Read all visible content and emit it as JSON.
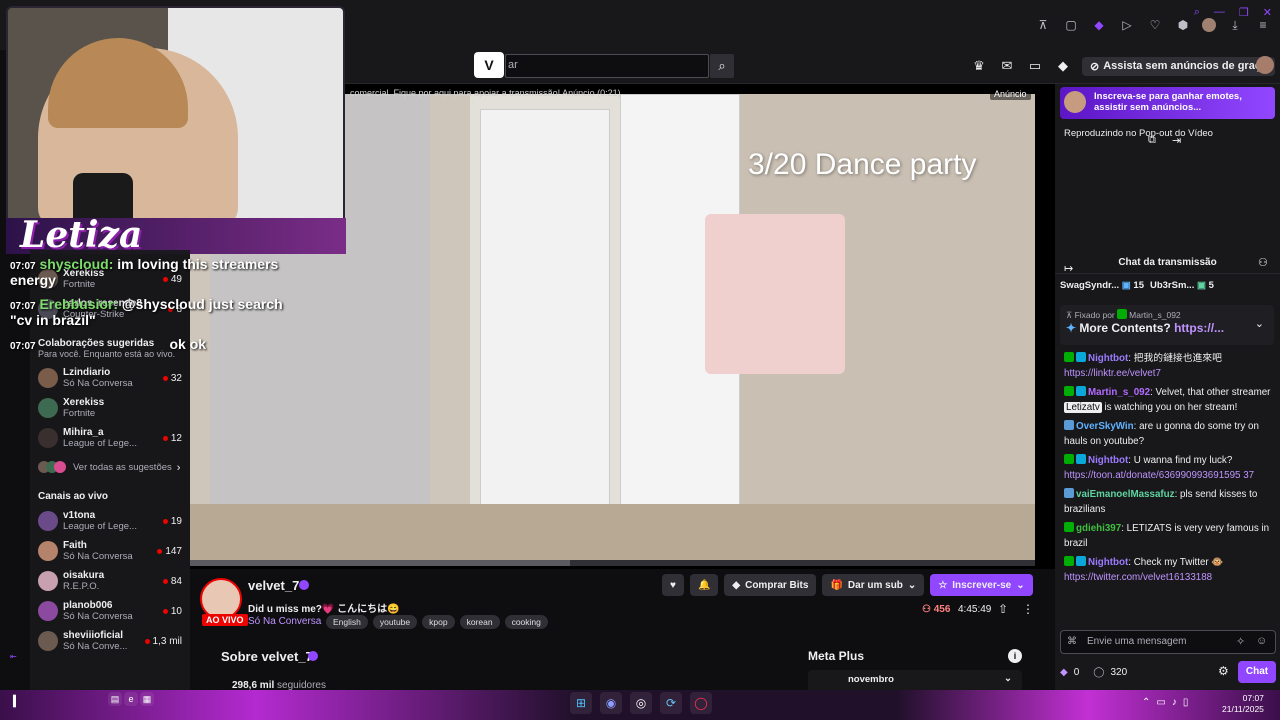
{
  "browser": {
    "window_controls": [
      "⌕",
      "—",
      "❐",
      "✕"
    ],
    "toolbar_icons": [
      "pin-icon",
      "cast-icon",
      "shield-icon",
      "play-icon",
      "heart-icon",
      "extensions-icon",
      "avatar",
      "download-icon",
      "menu-icon"
    ]
  },
  "nav": {
    "logo": "V",
    "search_placeholder": "ar",
    "noads_label": "Assista sem anúncios de graça"
  },
  "overlay": {
    "brand": "Letiza",
    "chat_lines": [
      {
        "time": "07:07",
        "user": "shyscloud:",
        "text": " im loving this streamers"
      },
      {
        "time": "",
        "user": "",
        "text": "energy"
      },
      {
        "time": "07:07",
        "user": "Erebbusior:",
        "text": " @shyscloud just search"
      },
      {
        "time": "",
        "user": "",
        "text": "\"cv in brazil\""
      },
      {
        "time": "07:07",
        "user": "",
        "text": "ok ok"
      }
    ]
  },
  "sidebar": {
    "peek": [
      {
        "name": "Xerekiss",
        "game": "Fortnite",
        "viewers": "49"
      },
      {
        "name": "carlos_resende8",
        "game": "Counter-Strike",
        "viewers": "8"
      }
    ],
    "collab_title": "Colaborações sugeridas",
    "collab_sub": "Para você. Enquanto está ao vivo.",
    "collab": [
      {
        "name": "Lzindiario",
        "game": "Só Na Conversa",
        "viewers": "32",
        "color": "#7a5c4a"
      },
      {
        "name": "Xerekiss",
        "game": "Fortnite",
        "viewers": "",
        "color": "#3d6b52"
      },
      {
        "name": "Mihira_a",
        "game": "League of Lege...",
        "viewers": "12",
        "color": "#3a2f2f"
      }
    ],
    "see_all": "Ver todas as sugestões",
    "live_title": "Canais ao vivo",
    "live": [
      {
        "name": "v1tona",
        "game": "League of Lege...",
        "viewers": "19",
        "color": "#6b4a8a"
      },
      {
        "name": "Faith",
        "game": "Só Na Conversa",
        "viewers": "147",
        "color": "#b5836b"
      },
      {
        "name": "oisakura",
        "game": "R.E.P.O.",
        "viewers": "84",
        "color": "#c9a0b0"
      },
      {
        "name": "planob006",
        "game": "Só Na Conversa",
        "viewers": "10",
        "color": "#8b4aa0"
      },
      {
        "name": "sheviiioficial",
        "game": "Só Na Conve...",
        "viewers": "1,3 mil",
        "color": "#6a5a50"
      }
    ]
  },
  "player": {
    "ad_text": "comercial. Fique por aqui para apoiar a transmissão! Anúncio (0:21)",
    "ad_tag": "Anúncio",
    "overlay_title": "3/20 Dance party",
    "progress": 0.45
  },
  "channel": {
    "name": "velvet_7",
    "live": "AO VIVO",
    "title": "Did u miss me?💗 こんにちは😄",
    "category": "Só Na Conversa",
    "tags": [
      "English",
      "youtube",
      "kpop",
      "korean",
      "cooking"
    ],
    "bits": "Comprar Bits",
    "gift": "Dar um sub",
    "subscribe": "Inscrever-se",
    "viewers": "456",
    "uptime": "4:45:49",
    "about": "Sobre velvet_7",
    "followers_num": "298,6 mil",
    "followers_label": " seguidores",
    "meta_title": "Meta Plus",
    "meta_month": "novembro"
  },
  "chat": {
    "promo": "Inscreva-se para ganhar emotes, assistir sem anúncios...",
    "popout": "Reproduzindo no Pop-out do Vídeo",
    "header": "Chat da transmissão",
    "gifters": [
      {
        "name": "SwagSyndr...",
        "count": "15"
      },
      {
        "name": "Ub3rSm...",
        "count": "5"
      }
    ],
    "pinned_by_label": "Fixado por",
    "pinned_by": "Martin_s_092",
    "pinned_text": "More Contents? ",
    "pinned_link": "https://...",
    "messages": [
      {
        "user": "Nightbot",
        "color": "#9b7bff",
        "text": ": 把我的鏈接也進來吧 ",
        "link": "https://linktr.ee/velvet7",
        "badges": [
          "b-mod",
          "b-vip"
        ]
      },
      {
        "user": "Martin_s_092",
        "color": "#b26bff",
        "text": ": Velvet, that other streamer ",
        "mention": "Letizatv",
        "after": " is watching you on her stream!",
        "badges": [
          "b-mod",
          "b-vip"
        ]
      },
      {
        "user": "OverSkyWin",
        "color": "#5fb3ff",
        "text": ": are u gonna do some try on hauls on youtube?",
        "badges": [
          "b-sub"
        ]
      },
      {
        "user": "Nightbot",
        "color": "#9b7bff",
        "text": ": U wanna find my luck? ",
        "link": "https://toon.at/donate/636990993691595 37",
        "badges": [
          "b-mod",
          "b-vip"
        ]
      },
      {
        "user": "vaiEmanoelMassafuz",
        "color": "#5fd3a0",
        "text": ": pls send kisses to brazilians",
        "badges": [
          "b-sub"
        ]
      },
      {
        "user": "gdiehi397",
        "color": "#3fbf3f",
        "text": ": LETIZATS is very very famous in brazil",
        "badges": [
          "b-mod"
        ]
      },
      {
        "user": "Nightbot",
        "color": "#9b7bff",
        "text": ": Check my Twitter 🐵 ",
        "link": "https://twitter.com/velvet16133188",
        "badges": [
          "b-mod",
          "b-vip"
        ]
      }
    ],
    "input_placeholder": "Envie uma mensagem",
    "bits_count": "0",
    "points": "320",
    "chat_button": "Chat"
  },
  "taskbar": {
    "time": "07:07",
    "date": "21/11/2025"
  }
}
